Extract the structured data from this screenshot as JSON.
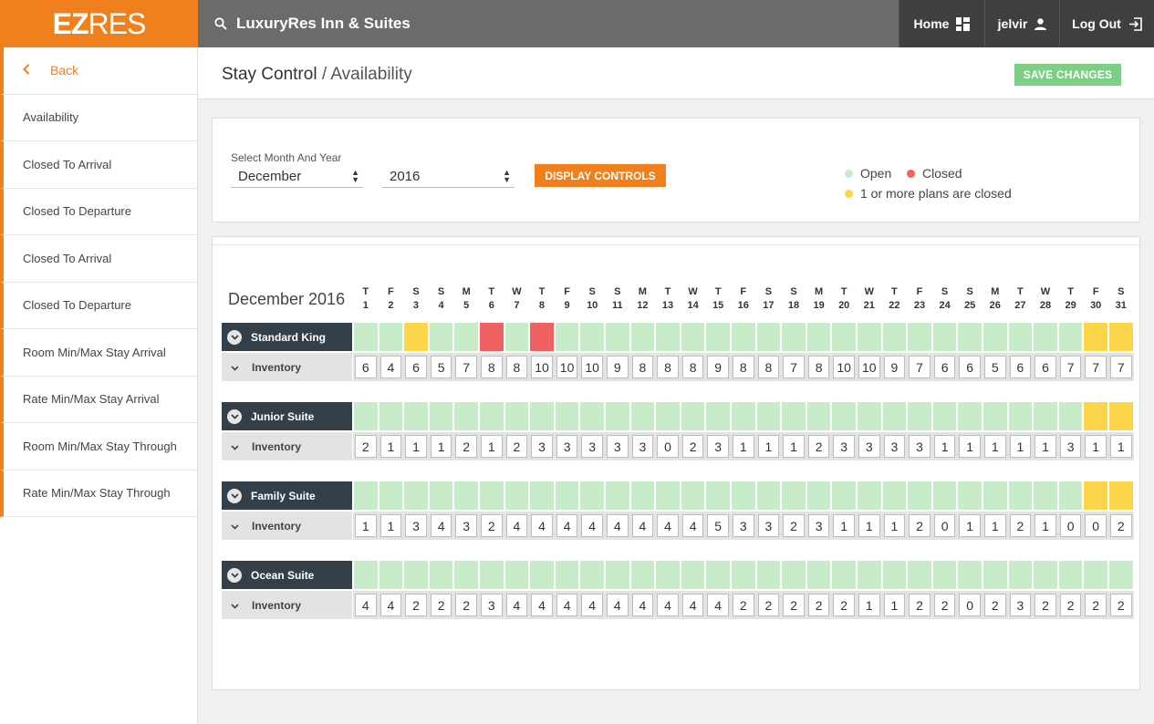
{
  "app": {
    "logo_bold": "EZ",
    "logo_light": "RES",
    "property": "LuxuryRes Inn & Suites"
  },
  "nav": {
    "home": "Home",
    "user": "jelvir",
    "logout": "Log Out"
  },
  "sidebar": {
    "back": "Back",
    "items": [
      "Availability",
      "Closed To Arrival",
      "Closed To Departure",
      "Closed To Arrival",
      "Closed To Departure",
      "Room Min/Max Stay Arrival",
      "Rate Min/Max Stay Arrival",
      "Room Min/Max Stay Through",
      "Rate Min/Max Stay Through"
    ]
  },
  "header": {
    "section": "Stay Control",
    "separator": "/",
    "page": "Availability",
    "save": "SAVE CHANGES"
  },
  "controls": {
    "select_label": "Select Month And Year",
    "month": "December",
    "year": "2016",
    "display": "DISPLAY CONTROLS"
  },
  "legend": {
    "open": "Open",
    "closed": "Closed",
    "partial": "1 or more plans are closed",
    "colors": {
      "open": "#c8ebc9",
      "closed": "#f06262",
      "partial": "#fcd54a"
    }
  },
  "calendar": {
    "title": "December 2016",
    "weekdays": [
      "T",
      "F",
      "S",
      "S",
      "M",
      "T",
      "W",
      "T",
      "F",
      "S",
      "S",
      "M",
      "T",
      "W",
      "T",
      "F",
      "S",
      "S",
      "M",
      "T",
      "W",
      "T",
      "F",
      "S",
      "S",
      "M",
      "T",
      "W",
      "T",
      "F",
      "S"
    ],
    "days": [
      "1",
      "2",
      "3",
      "4",
      "5",
      "6",
      "7",
      "8",
      "9",
      "10",
      "11",
      "12",
      "13",
      "14",
      "15",
      "16",
      "17",
      "18",
      "19",
      "20",
      "21",
      "22",
      "23",
      "24",
      "25",
      "26",
      "27",
      "28",
      "29",
      "30",
      "31"
    ],
    "inventory_label": "Inventory",
    "rooms": [
      {
        "name": "Standard King",
        "status": [
          "o",
          "o",
          "p",
          "o",
          "o",
          "c",
          "o",
          "c",
          "o",
          "o",
          "o",
          "o",
          "o",
          "o",
          "o",
          "o",
          "o",
          "o",
          "o",
          "o",
          "o",
          "o",
          "o",
          "o",
          "o",
          "o",
          "o",
          "o",
          "o",
          "p",
          "p"
        ],
        "inventory": [
          "6",
          "4",
          "6",
          "5",
          "7",
          "8",
          "8",
          "10",
          "10",
          "10",
          "9",
          "8",
          "8",
          "8",
          "9",
          "8",
          "8",
          "7",
          "8",
          "10",
          "10",
          "9",
          "7",
          "6",
          "6",
          "5",
          "6",
          "6",
          "7",
          "7",
          "7"
        ]
      },
      {
        "name": "Junior Suite",
        "status": [
          "o",
          "o",
          "o",
          "o",
          "o",
          "o",
          "o",
          "o",
          "o",
          "o",
          "o",
          "o",
          "o",
          "o",
          "o",
          "o",
          "o",
          "o",
          "o",
          "o",
          "o",
          "o",
          "o",
          "o",
          "o",
          "o",
          "o",
          "o",
          "o",
          "p",
          "p"
        ],
        "inventory": [
          "2",
          "1",
          "1",
          "1",
          "2",
          "1",
          "2",
          "3",
          "3",
          "3",
          "3",
          "3",
          "0",
          "2",
          "3",
          "1",
          "1",
          "1",
          "2",
          "3",
          "3",
          "3",
          "3",
          "1",
          "1",
          "1",
          "1",
          "1",
          "3",
          "1",
          "1"
        ]
      },
      {
        "name": "Family Suite",
        "status": [
          "o",
          "o",
          "o",
          "o",
          "o",
          "o",
          "o",
          "o",
          "o",
          "o",
          "o",
          "o",
          "o",
          "o",
          "o",
          "o",
          "o",
          "o",
          "o",
          "o",
          "o",
          "o",
          "o",
          "o",
          "o",
          "o",
          "o",
          "o",
          "o",
          "p",
          "p"
        ],
        "inventory": [
          "1",
          "1",
          "3",
          "4",
          "3",
          "2",
          "4",
          "4",
          "4",
          "4",
          "4",
          "4",
          "4",
          "4",
          "5",
          "3",
          "3",
          "2",
          "3",
          "1",
          "1",
          "1",
          "2",
          "0",
          "1",
          "1",
          "2",
          "1",
          "0",
          "0",
          "2"
        ]
      },
      {
        "name": "Ocean Suite",
        "status": [
          "o",
          "o",
          "o",
          "o",
          "o",
          "o",
          "o",
          "o",
          "o",
          "o",
          "o",
          "o",
          "o",
          "o",
          "o",
          "o",
          "o",
          "o",
          "o",
          "o",
          "o",
          "o",
          "o",
          "o",
          "o",
          "o",
          "o",
          "o",
          "o",
          "o",
          "o"
        ],
        "inventory": [
          "4",
          "4",
          "2",
          "2",
          "2",
          "3",
          "4",
          "4",
          "4",
          "4",
          "4",
          "4",
          "4",
          "4",
          "4",
          "2",
          "2",
          "2",
          "2",
          "2",
          "1",
          "1",
          "2",
          "2",
          "0",
          "2",
          "3",
          "2",
          "2",
          "2",
          "2"
        ]
      }
    ]
  }
}
